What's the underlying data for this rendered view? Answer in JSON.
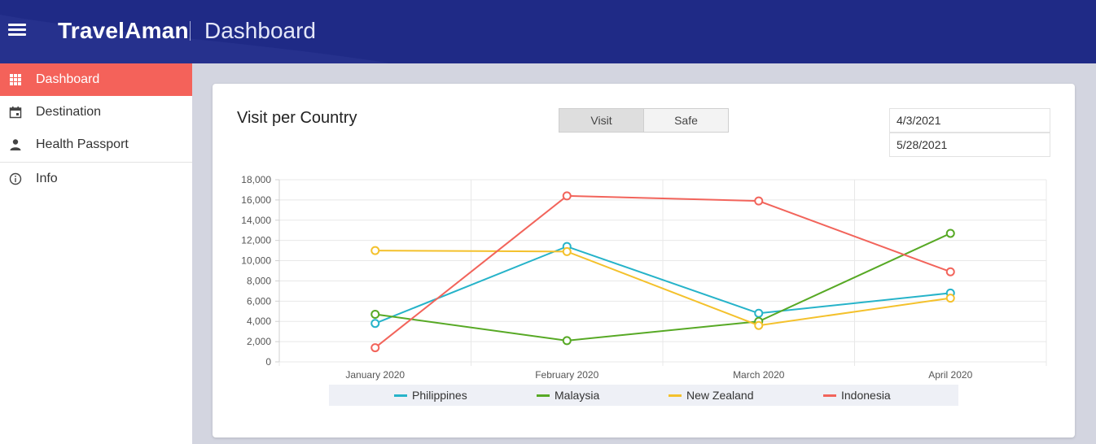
{
  "header": {
    "brand": "TravelAman",
    "page_name": "Dashboard",
    "bar_color": "#1f2a86"
  },
  "sidebar": {
    "items": [
      {
        "label": "Dashboard",
        "icon": "grid-icon",
        "active": true
      },
      {
        "label": "Destination",
        "icon": "calendar-icon",
        "active": false
      },
      {
        "label": "Health Passport",
        "icon": "person-icon",
        "active": false
      },
      {
        "label": "Info",
        "icon": "info-icon",
        "active": false
      }
    ],
    "active_color": "#f4625a"
  },
  "card": {
    "title": "Visit per Country",
    "toggle": {
      "visit_label": "Visit",
      "safe_label": "Safe",
      "selected": "Visit"
    },
    "date_from": "4/3/2021",
    "date_to": "5/28/2021"
  },
  "chart_data": {
    "type": "line",
    "title": "",
    "xlabel": "",
    "ylabel": "",
    "categories": [
      "January 2020",
      "February 2020",
      "March 2020",
      "April 2020"
    ],
    "ylim": [
      0,
      18000
    ],
    "y_ticks": [
      "0",
      "2,000",
      "4,000",
      "6,000",
      "8,000",
      "10,000",
      "12,000",
      "14,000",
      "16,000",
      "18,000"
    ],
    "grid": true,
    "legend_position": "bottom",
    "series": [
      {
        "name": "Philippines",
        "color": "#26b3c9",
        "values": [
          3800,
          11400,
          4800,
          6800
        ]
      },
      {
        "name": "Malaysia",
        "color": "#57a925",
        "values": [
          4700,
          2100,
          4000,
          12700
        ]
      },
      {
        "name": "New Zealand",
        "color": "#f4c12c",
        "values": [
          11000,
          10900,
          3600,
          6300
        ]
      },
      {
        "name": "Indonesia",
        "color": "#f2645b",
        "values": [
          1400,
          16400,
          15900,
          8900
        ]
      }
    ]
  }
}
